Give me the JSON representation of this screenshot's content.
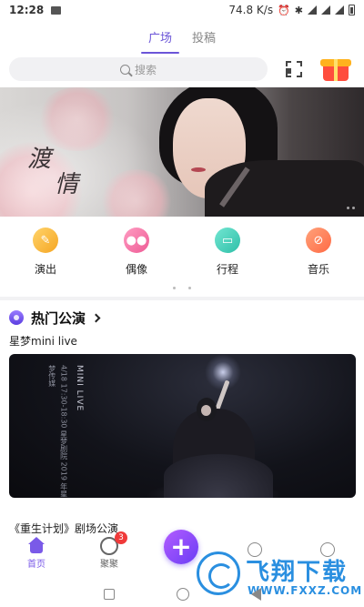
{
  "status_bar": {
    "time": "12:28",
    "speed": "74.8 K/s"
  },
  "tabs": [
    {
      "label": "广场",
      "active": true
    },
    {
      "label": "投稿",
      "active": false
    }
  ],
  "search": {
    "placeholder": "搜索"
  },
  "banner": {
    "calligraphy_line1": "渡",
    "calligraphy_line2": "情"
  },
  "categories": [
    {
      "label": "演出",
      "icon": "ticket-icon",
      "color": "#f5b23a"
    },
    {
      "label": "偶像",
      "icon": "people-icon",
      "color": "#f06aa0"
    },
    {
      "label": "行程",
      "icon": "calendar-icon",
      "color": "#3fcfb8"
    },
    {
      "label": "音乐",
      "icon": "music-icon",
      "color": "#ff7a52"
    }
  ],
  "hot_section": {
    "title": "热门公演",
    "show1_name": "星梦mini live",
    "show1_poster": {
      "logo": "MINI LIVE",
      "caption": "4/18 17:30-18:30 星梦剧院 2019 年星梦传媒"
    },
    "show2_name": "《重生计划》剧场公演"
  },
  "bottom_nav": {
    "home_label": "首页",
    "group_label": "聚聚",
    "group_badge": "3",
    "fab_label": "+"
  },
  "watermark": {
    "title": "飞翔下载",
    "url": "WWW.FXXZ.COM"
  },
  "colors": {
    "accent": "#6b55d8",
    "fab": "#8a4df7",
    "badge": "#f03a3a",
    "watermark": "#2a8fe0"
  }
}
